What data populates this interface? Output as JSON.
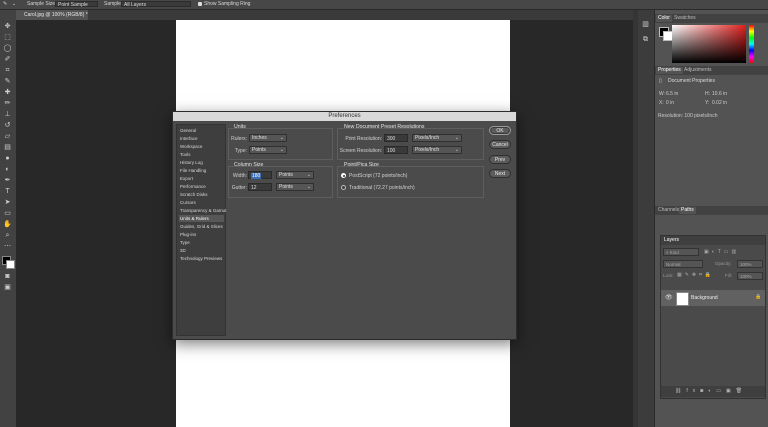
{
  "options_bar": {
    "sample_size_label": "Sample Size:",
    "sample_size_value": "Point Sample",
    "sample_label": "Sample:",
    "sample_value": "All Layers",
    "show_ring_label": "Show Sampling Ring",
    "show_ring_checked": true
  },
  "document_tab": {
    "title": "Carol.jpg @ 100% (RGB/8) *"
  },
  "color_panel": {
    "tabs": [
      "Color",
      "Swatches"
    ],
    "foreground": "#000000",
    "background": "#ffffff"
  },
  "properties_panel": {
    "tabs": [
      "Properties",
      "Adjustments"
    ],
    "section_title": "Document Properties",
    "W": "6.5 in",
    "H": "10.6 in",
    "X": "0 in",
    "Y": "0.02 in",
    "resolution": "Resolution: 100 pixels/inch"
  },
  "channels_panel": {
    "tabs": [
      "Channels",
      "Paths"
    ]
  },
  "layers_panel": {
    "title": "Layers",
    "kind_label": "Kind",
    "blend_mode": "Normal",
    "opacity_label": "Opacity:",
    "opacity_value": "100%",
    "lock_label": "Lock:",
    "fill_label": "Fill:",
    "fill_value": "100%",
    "layers": [
      {
        "name": "Background"
      }
    ]
  },
  "dialog": {
    "title": "Preferences",
    "categories": [
      "General",
      "Interface",
      "Workspace",
      "Tools",
      "History Log",
      "File Handling",
      "Export",
      "Performance",
      "Scratch Disks",
      "Cursors",
      "Transparency & Gamut",
      "Units & Rulers",
      "Guides, Grid & Slices",
      "Plug-ins",
      "Type",
      "3D",
      "Technology Previews"
    ],
    "active_category": "Units & Rulers",
    "units": {
      "title": "Units",
      "rulers_label": "Rulers:",
      "rulers_value": "Inches",
      "type_label": "Type:",
      "type_value": "Points"
    },
    "column_size": {
      "title": "Column Size",
      "width_label": "Width:",
      "width_value": "180",
      "width_unit": "Points",
      "gutter_label": "Gutter:",
      "gutter_value": "12",
      "gutter_unit": "Points"
    },
    "preset": {
      "title": "New Document Preset Resolutions",
      "print_label": "Print Resolution:",
      "print_value": "300",
      "print_unit": "Pixels/Inch",
      "screen_label": "Screen Resolution:",
      "screen_value": "100",
      "screen_unit": "Pixels/Inch"
    },
    "pica": {
      "title": "Point/Pica Size",
      "option1": "PostScript (72 points/inch)",
      "option2": "Traditional (72.27 points/inch)",
      "selected": "option1"
    },
    "buttons": {
      "ok": "OK",
      "cancel": "Cancel",
      "prev": "Prev",
      "next": "Next"
    }
  }
}
